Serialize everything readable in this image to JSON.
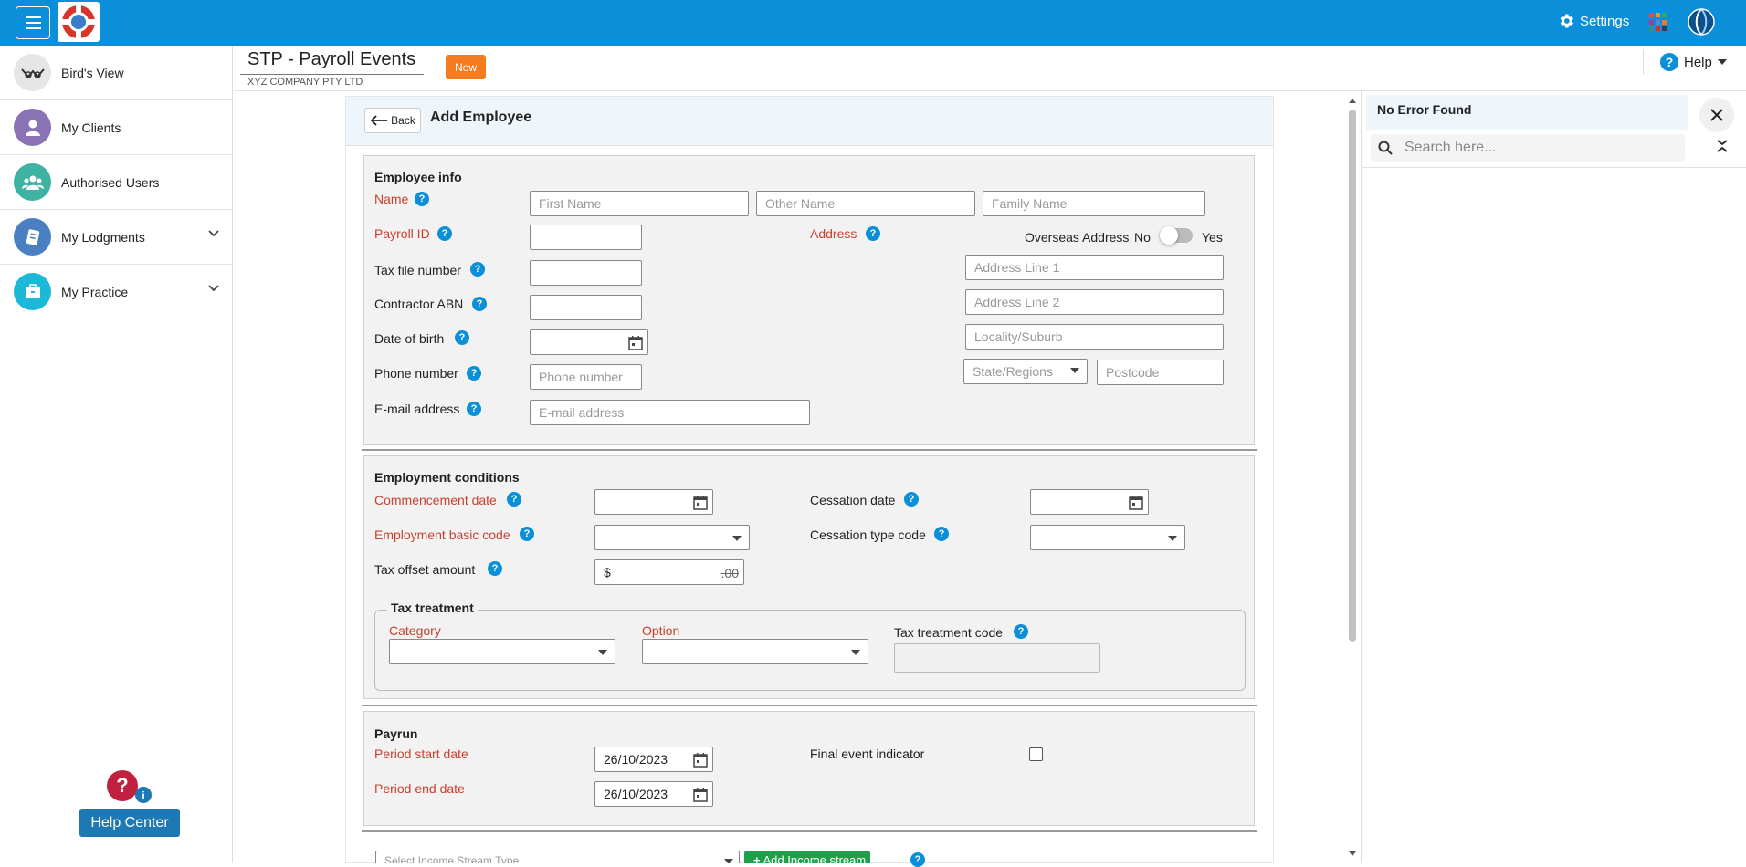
{
  "sidebar": {
    "items": [
      {
        "label": "Bird's View"
      },
      {
        "label": "My Clients"
      },
      {
        "label": "Authorised Users"
      },
      {
        "label": "My Lodgments"
      },
      {
        "label": "My Practice"
      }
    ],
    "help_center": "Help Center"
  },
  "topbar": {
    "settings": "Settings"
  },
  "header": {
    "title": "STP - Payroll Events",
    "company": "XYZ COMPANY PTY LTD",
    "badge": "New",
    "help": "Help"
  },
  "form": {
    "back": "Back",
    "title": "Add Employee",
    "employee_info": {
      "heading": "Employee info",
      "name": "Name",
      "first_name_ph": "First Name",
      "other_name_ph": "Other Name",
      "family_name_ph": "Family Name",
      "payroll_id": "Payroll ID",
      "address": "Address",
      "overseas": "Overseas Address",
      "no": "No",
      "yes": "Yes",
      "tfn": "Tax file number",
      "abn": "Contractor ABN",
      "dob": "Date of birth",
      "phone": "Phone number",
      "phone_ph": "Phone number",
      "email": "E-mail address",
      "email_ph": "E-mail address",
      "addr1_ph": "Address Line 1",
      "addr2_ph": "Address Line 2",
      "locality_ph": "Locality/Suburb",
      "state_ph": "State/Regions",
      "postcode_ph": "Postcode"
    },
    "employment": {
      "heading": "Employment conditions",
      "commencement": "Commencement date",
      "cessation": "Cessation date",
      "basic_code": "Employment basic code",
      "cessation_type": "Cessation type code",
      "tax_offset": "Tax offset amount",
      "currency": "$",
      "cents": ".00",
      "tax_treatment": "Tax treatment",
      "category": "Category",
      "option": "Option",
      "tax_code": "Tax treatment code"
    },
    "payrun": {
      "heading": "Payrun",
      "period_start": "Period start date",
      "period_start_val": "26/10/2023",
      "period_end": "Period end date",
      "period_end_val": "26/10/2023",
      "final_event": "Final event indicator"
    },
    "income": {
      "select_ph": "Select Income Stream Type",
      "add": "Add Income stream"
    }
  },
  "right_panel": {
    "status": "No Error Found",
    "search_ph": "Search here..."
  },
  "colors": {
    "topbar": "#0a8fd8",
    "required": "#c8412e",
    "badge": "#f47b20",
    "add_button": "#1e9f4a",
    "help_button": "#1e78b4"
  }
}
